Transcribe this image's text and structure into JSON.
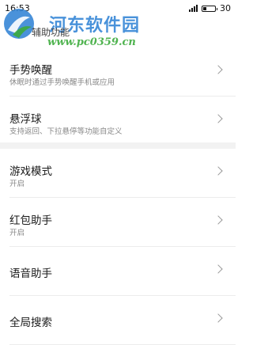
{
  "status_bar": {
    "time": "16:53",
    "battery": "30",
    "battery_level": 0.3
  },
  "watermark": {
    "title": "河东软件园",
    "url": "www.pc0359.cn"
  },
  "header": {
    "title": "辅助功能"
  },
  "section1": {
    "items": [
      {
        "label": "手势唤醒",
        "desc": "休眠时通过手势唤醒手机或应用"
      },
      {
        "label": "悬浮球",
        "desc": "支持返回、下拉悬停等功能自定义"
      }
    ]
  },
  "section2": {
    "items": [
      {
        "label": "游戏模式",
        "desc": "开启"
      },
      {
        "label": "红包助手",
        "desc": "开启"
      },
      {
        "label": "语音助手"
      },
      {
        "label": "全局搜索"
      }
    ]
  },
  "colors": {
    "watermark_blue": "#2a7fd4",
    "watermark_green": "#3cab3c",
    "divider": "#ececec",
    "section_gap": "#f2f2f2"
  },
  "icons": {
    "chevron": "chevron-right-icon",
    "signal": "signal-icon",
    "battery": "battery-icon"
  }
}
